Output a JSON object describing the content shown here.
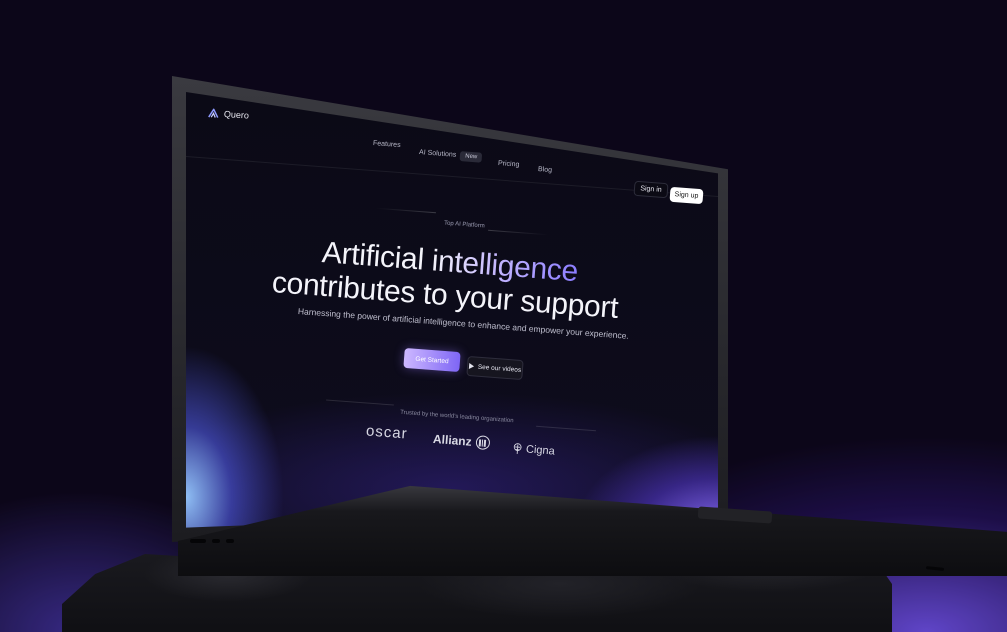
{
  "app": {
    "name": "Quero",
    "logo_icon": "quero-logo-icon"
  },
  "nav": {
    "items": [
      "Features",
      "AI Solutions",
      "Pricing",
      "Blog"
    ],
    "new_badge": "New",
    "sign_in": "Sign in",
    "sign_up": "Sign up"
  },
  "hero": {
    "tag": "Top AI Platform",
    "title_line1_part1": "Artificial ",
    "title_line1_part2": "intelligence",
    "title_line2": "contributes to your support",
    "subtitle": "Harnessing the power of artificial intelligence to enhance and empower your experience.",
    "cta_primary": "Get Started",
    "cta_secondary": "See our videos",
    "cta_secondary_icon": "play-icon"
  },
  "trusted": {
    "label": "Trusted by the world's leading organization",
    "logos": [
      "oscar",
      "Allianz",
      "Cigna"
    ]
  },
  "colors": {
    "background": "#0c0619",
    "accent_start": "#cdb8ff",
    "accent_end": "#7e66f5",
    "glow": "#6e50e6"
  }
}
